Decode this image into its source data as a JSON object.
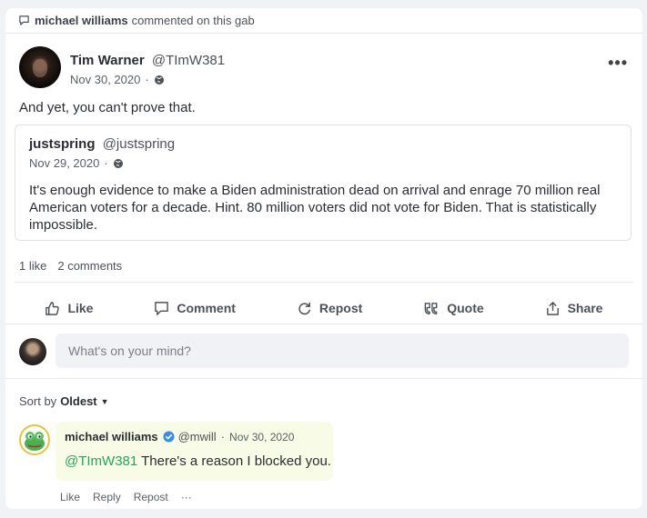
{
  "activity": {
    "actor": "michael williams",
    "text": "commented on this gab"
  },
  "post": {
    "author_name": "Tim Warner",
    "author_handle": "@TImW381",
    "date": "Nov 30, 2020",
    "separator": "·",
    "more_label": "•••",
    "body": "And yet, you can't prove that."
  },
  "quote": {
    "author_name": "justspring",
    "author_handle": "@justspring",
    "date": "Nov 29, 2020",
    "separator": "·",
    "body": "It's enough evidence to make a Biden administration dead on arrival and enrage 70 million real American voters for a decade. Hint. 80 million voters did not vote for Biden. That is statistically impossible."
  },
  "stats": {
    "likes": "1 like",
    "comments": "2 comments"
  },
  "actions": {
    "like": "Like",
    "comment": "Comment",
    "repost": "Repost",
    "quote": "Quote",
    "share": "Share"
  },
  "composer": {
    "placeholder": "What's on your mind?"
  },
  "sort": {
    "label": "Sort by",
    "value": "Oldest"
  },
  "comment": {
    "author_name": "michael williams",
    "author_handle": "@mwill",
    "separator": "·",
    "date": "Nov 30, 2020",
    "mention": "@TImW381",
    "body": " There's a reason I blocked you.",
    "actions": {
      "like": "Like",
      "reply": "Reply",
      "repost": "Repost",
      "more": "···"
    }
  },
  "colors": {
    "accent_green": "#2aa35a",
    "verified_blue": "#3a8ee6",
    "comment_bubble": "#f8fbe5",
    "card_bg": "#ffffff",
    "page_bg": "#f0f2f5"
  }
}
